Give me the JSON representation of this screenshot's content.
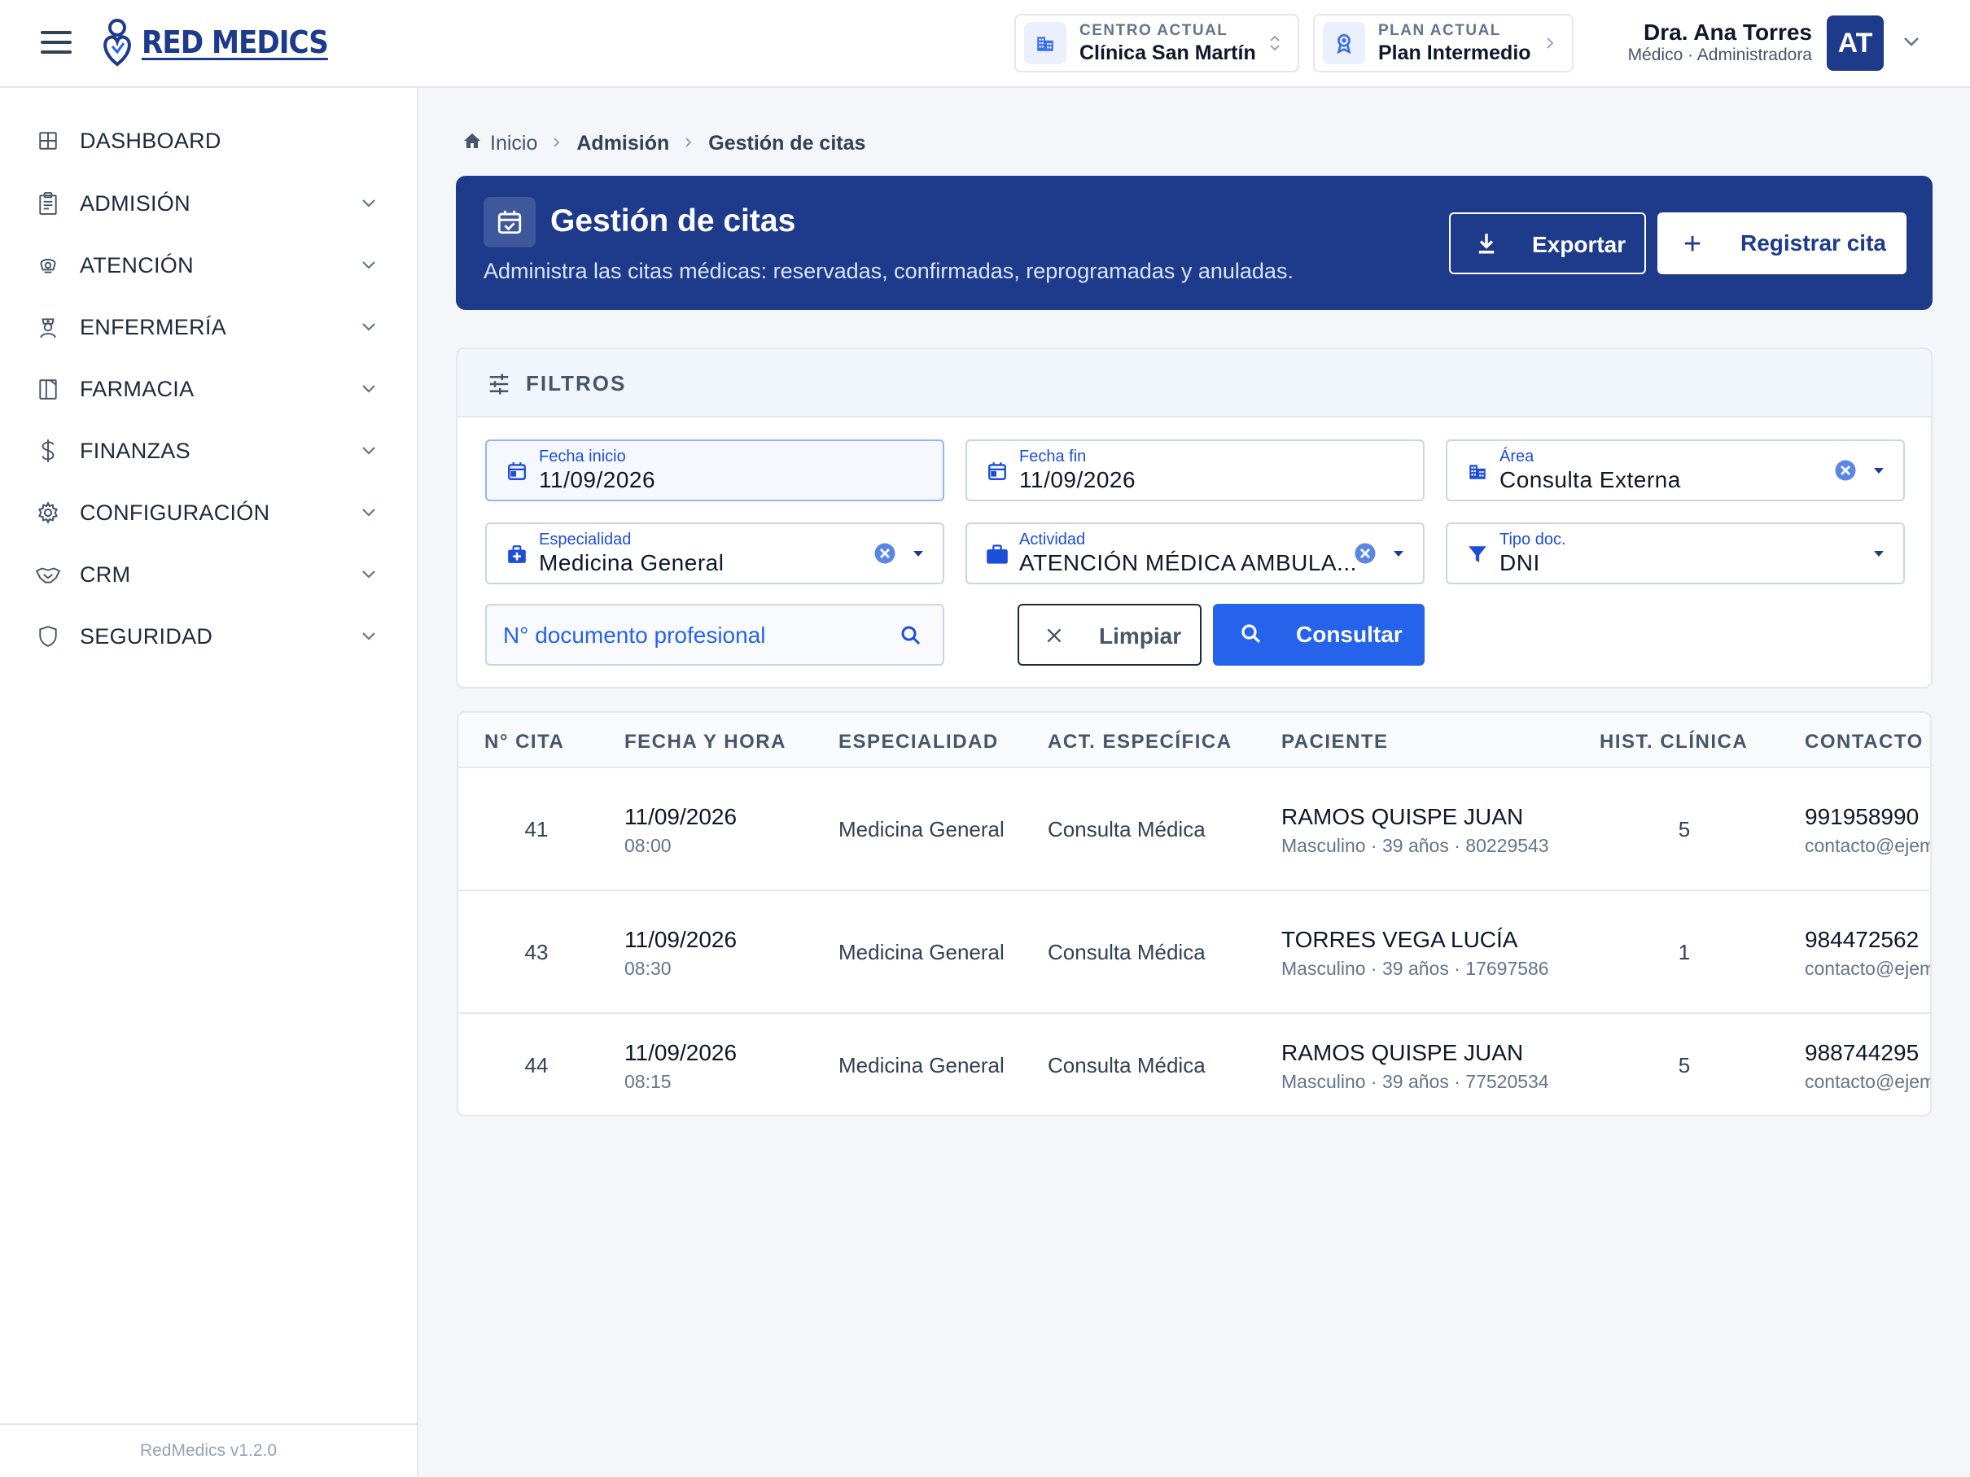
{
  "app": {
    "brand": "RED MEDICS",
    "version": "RedMedics v1.2.0"
  },
  "context": {
    "center_label": "CENTRO ACTUAL",
    "center_value": "Clínica San Martín",
    "plan_label": "PLAN ACTUAL",
    "plan_value": "Plan Intermedio"
  },
  "user": {
    "name": "Dra. Ana Torres",
    "role": "Médico · Administradora",
    "initials": "AT"
  },
  "sidebar": {
    "items": [
      {
        "label": "DASHBOARD",
        "icon": "dashboard-icon"
      },
      {
        "label": "ADMISIÓN",
        "icon": "clipboard-icon"
      },
      {
        "label": "ATENCIÓN",
        "icon": "stethoscope-icon"
      },
      {
        "label": "ENFERMERÍA",
        "icon": "nurse-icon"
      },
      {
        "label": "FARMACIA",
        "icon": "pharmacy-icon"
      },
      {
        "label": "FINANZAS",
        "icon": "dollar-icon"
      },
      {
        "label": "CONFIGURACIÓN",
        "icon": "gear-icon"
      },
      {
        "label": "CRM",
        "icon": "handshake-icon"
      },
      {
        "label": "SEGURIDAD",
        "icon": "shield-icon"
      }
    ]
  },
  "breadcrumb": {
    "home": "Inicio",
    "section": "Admisión",
    "current": "Gestión de citas"
  },
  "hero": {
    "title": "Gestión de citas",
    "subtitle": "Administra las citas médicas: reservadas, confirmadas, reprogramadas y anuladas.",
    "export_label": "Exportar",
    "register_label": "Registrar cita"
  },
  "filters": {
    "title": "FILTROS",
    "fecha_inicio": {
      "label": "Fecha inicio",
      "value": "11/09/2026"
    },
    "fecha_fin": {
      "label": "Fecha fin",
      "value": "11/09/2026"
    },
    "area": {
      "label": "Área",
      "value": "Consulta Externa"
    },
    "especialidad": {
      "label": "Especialidad",
      "value": "Medicina General"
    },
    "actividad": {
      "label": "Actividad",
      "value": "ATENCIÓN MÉDICA AMBULA..."
    },
    "tipo_doc": {
      "label": "Tipo doc.",
      "value": "DNI"
    },
    "doc_placeholder": "N° documento profesional",
    "clear_label": "Limpiar",
    "query_label": "Consultar"
  },
  "table": {
    "headers": [
      "N° CITA",
      "FECHA Y HORA",
      "ESPECIALIDAD",
      "ACT. ESPECÍFICA",
      "PACIENTE",
      "HIST. CLÍNICA",
      "CONTACTO"
    ],
    "rows": [
      {
        "num": "41",
        "date": "11/09/2026",
        "time": "08:00",
        "specialty": "Medicina General",
        "activity": "Consulta Médica",
        "patient": "RAMOS QUISPE JUAN",
        "patient_info": "Masculino · 39 años · 80229543",
        "hc": "5",
        "phone": "991958990",
        "email": "contacto@ejem"
      },
      {
        "num": "43",
        "date": "11/09/2026",
        "time": "08:30",
        "specialty": "Medicina General",
        "activity": "Consulta Médica",
        "patient": "TORRES VEGA LUCÍA",
        "patient_info": "Masculino · 39 años · 17697586",
        "hc": "1",
        "phone": "984472562",
        "email": "contacto@ejem"
      },
      {
        "num": "44",
        "date": "11/09/2026",
        "time": "08:15",
        "specialty": "Medicina General",
        "activity": "Consulta Médica",
        "patient": "RAMOS QUISPE JUAN",
        "patient_info": "Masculino · 39 años · 77520534",
        "hc": "5",
        "phone": "988744295",
        "email": "contacto@ejem"
      }
    ]
  },
  "colors": {
    "primary": "#1e3a8a",
    "accent": "#2563eb",
    "background": "#f4f6fa"
  }
}
